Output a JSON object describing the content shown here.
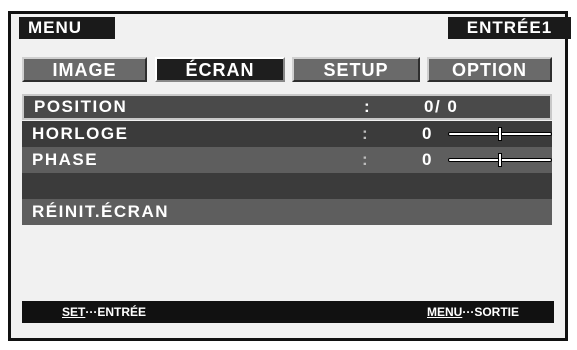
{
  "header": {
    "menu_label": "MENU",
    "input_label": "ENTRÉE1"
  },
  "tabs": [
    {
      "label": "IMAGE",
      "active": false
    },
    {
      "label": "ÉCRAN",
      "active": true
    },
    {
      "label": "SETUP",
      "active": false
    },
    {
      "label": "OPTION",
      "active": false
    }
  ],
  "rows": [
    {
      "label": "POSITION",
      "colon": ":",
      "value": "0/ 0"
    },
    {
      "label": "HORLOGE",
      "colon": ":",
      "value": "0",
      "slider_level": 0.5
    },
    {
      "label": "PHASE",
      "colon": ":",
      "value": "0",
      "slider_level": 0.5
    },
    {
      "label": ""
    },
    {
      "label": "RÉINIT.ÉCRAN"
    }
  ],
  "footer": {
    "enter_key": "SET",
    "enter_sep": "···",
    "enter_text": "ENTRÉE",
    "exit_key": "MENU",
    "exit_sep": "···",
    "exit_text": "SORTIE"
  },
  "colors": {
    "background": "#f1f1f1",
    "bar_dark": "#1a1a1a",
    "tab_inactive": "#6a6a6a",
    "row_dark": "#3b3b3b",
    "row_mid": "#5e5e5e",
    "text": "#ffffff"
  }
}
